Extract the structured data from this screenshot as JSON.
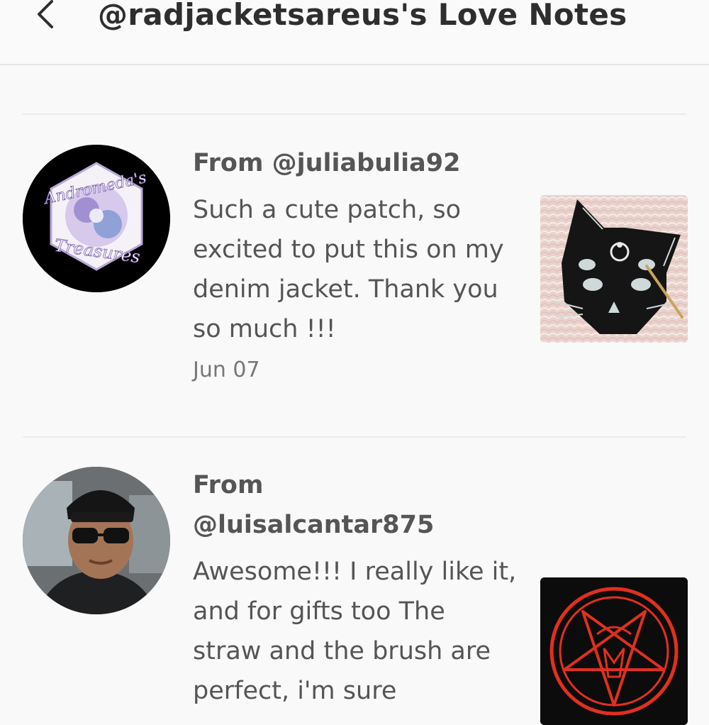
{
  "header": {
    "title": "@radjacketsareus's Love Notes",
    "back_icon": "chevron-left-icon"
  },
  "notes": [
    {
      "from_line1": "From @juliabulia92",
      "from_line2": "",
      "message": "Such a cute patch, so excited to put this on my denim jacket. Thank you so much !!!",
      "date": "Jun 07",
      "avatar_text_top": "Andromeda's",
      "avatar_text_bottom": "Treasures"
    },
    {
      "from_line1": "From",
      "from_line2": "@luisalcantar875",
      "message": "Awesome!!! I really like it, and for gifts too The straw and the brush are perfect, i'm sure"
    }
  ],
  "colors": {
    "background": "#f9f9f9",
    "title": "#2e2e2e",
    "text": "#555555",
    "date": "#777777",
    "pentagram": "#e0301e"
  }
}
